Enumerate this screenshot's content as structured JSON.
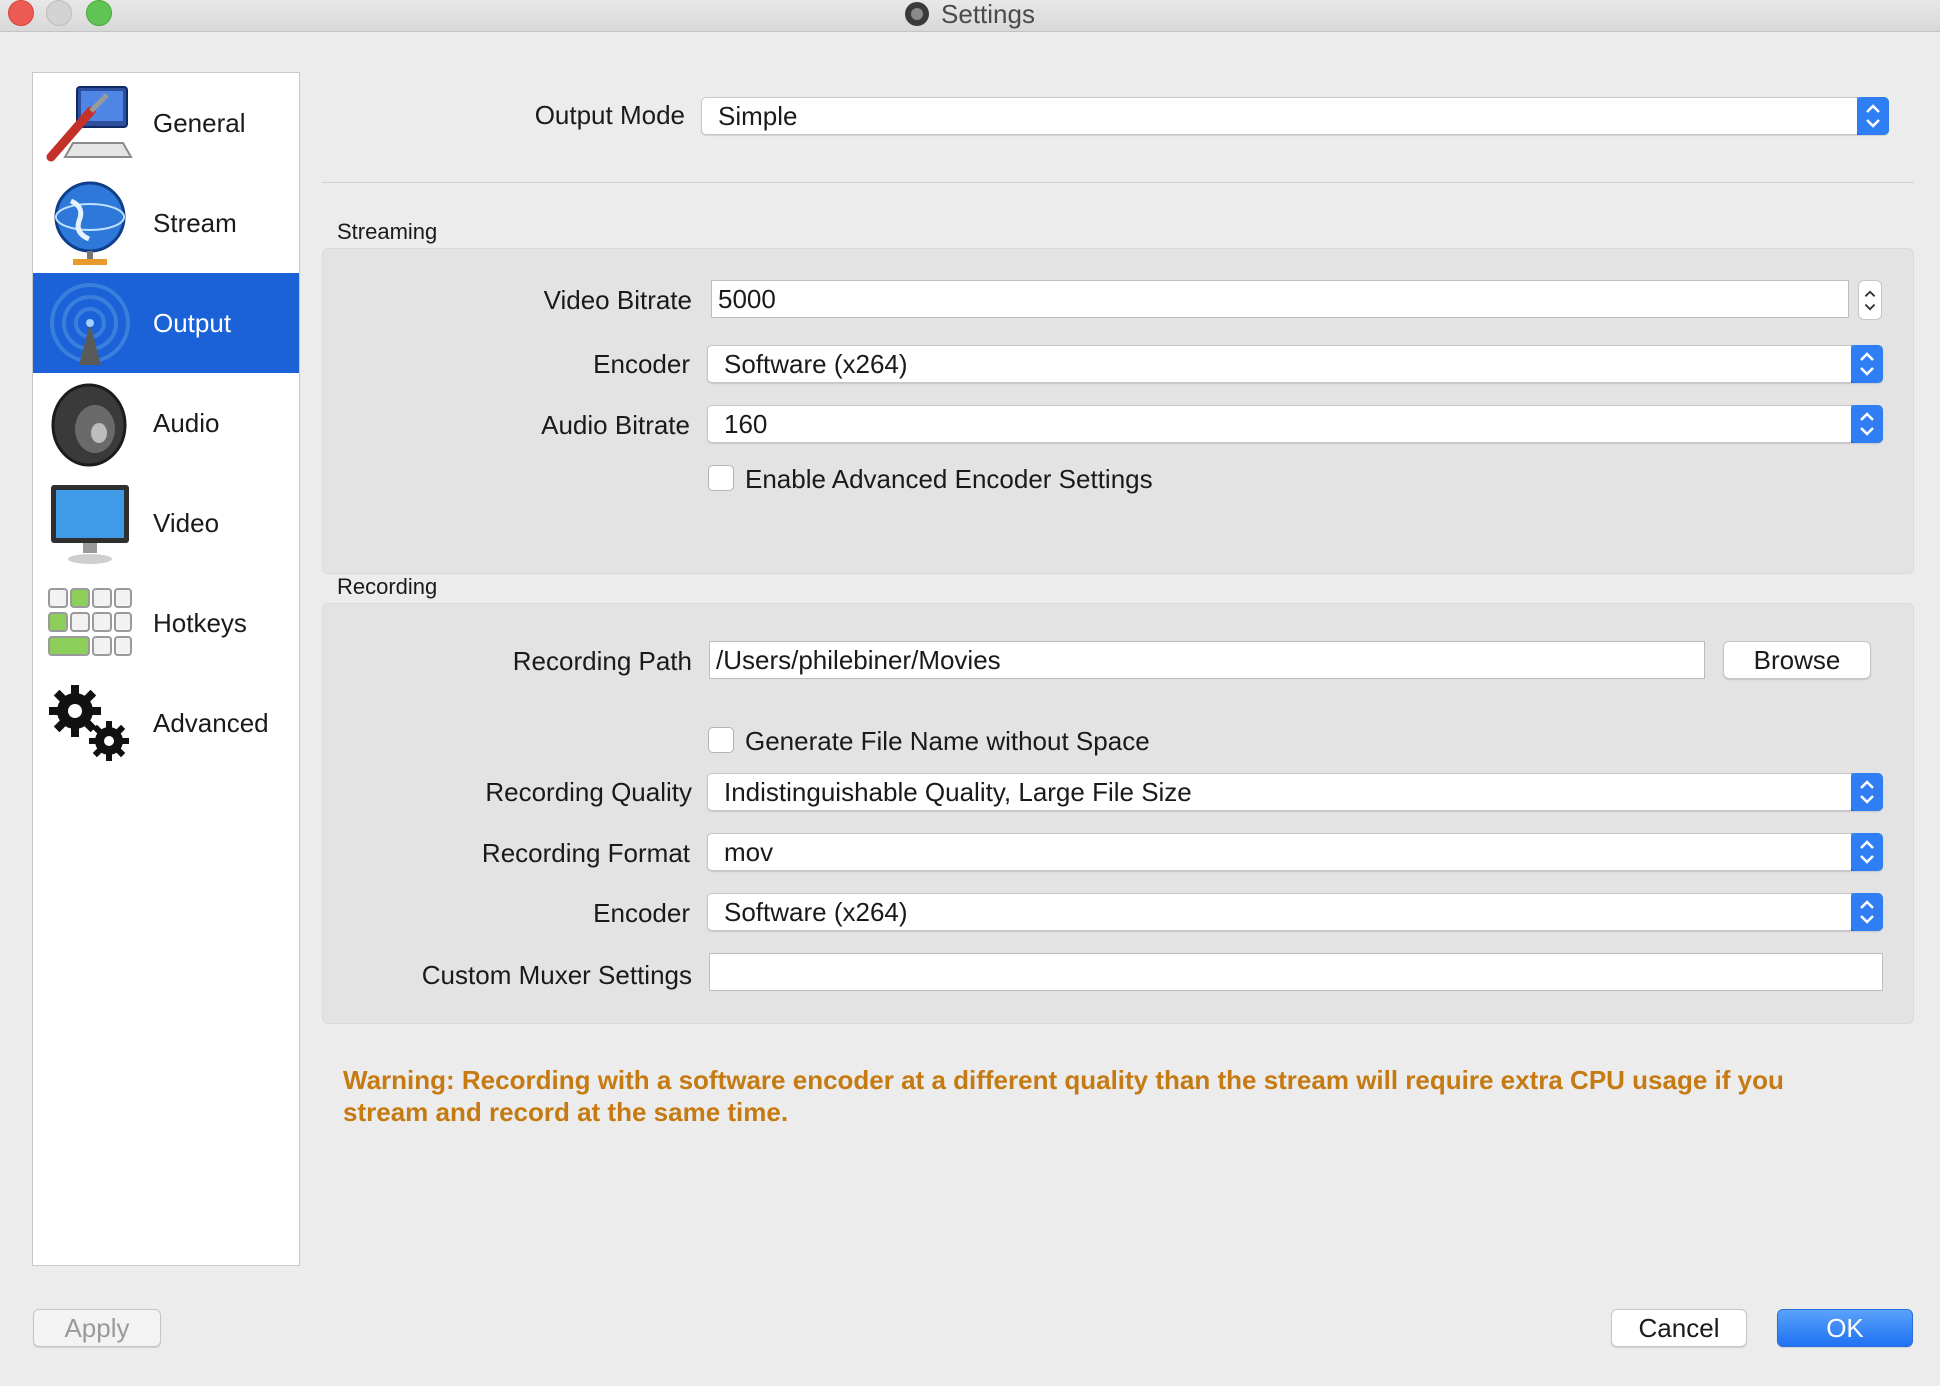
{
  "window": {
    "title": "Settings"
  },
  "sidebar": {
    "items": [
      {
        "label": "General",
        "icon": "general-icon",
        "active": false
      },
      {
        "label": "Stream",
        "icon": "globe-icon",
        "active": false
      },
      {
        "label": "Output",
        "icon": "broadcast-icon",
        "active": true
      },
      {
        "label": "Audio",
        "icon": "speaker-icon",
        "active": false
      },
      {
        "label": "Video",
        "icon": "monitor-icon",
        "active": false
      },
      {
        "label": "Hotkeys",
        "icon": "keyboard-icon",
        "active": false
      },
      {
        "label": "Advanced",
        "icon": "gears-icon",
        "active": false
      }
    ],
    "active_color": "#1b62d9"
  },
  "output_mode": {
    "label": "Output Mode",
    "value": "Simple"
  },
  "streaming": {
    "title": "Streaming",
    "video_bitrate": {
      "label": "Video Bitrate",
      "value": "5000"
    },
    "encoder": {
      "label": "Encoder",
      "value": "Software (x264)"
    },
    "audio_bitrate": {
      "label": "Audio Bitrate",
      "value": "160"
    },
    "advanced_encoder": {
      "label": "Enable Advanced Encoder Settings",
      "checked": false
    }
  },
  "recording": {
    "title": "Recording",
    "path": {
      "label": "Recording Path",
      "value": "/Users/philebiner/Movies",
      "browse_label": "Browse"
    },
    "no_space": {
      "label": "Generate File Name without Space",
      "checked": false
    },
    "quality": {
      "label": "Recording Quality",
      "value": "Indistinguishable Quality, Large File Size"
    },
    "format": {
      "label": "Recording Format",
      "value": "mov"
    },
    "encoder": {
      "label": "Encoder",
      "value": "Software (x264)"
    },
    "muxer": {
      "label": "Custom Muxer Settings",
      "value": ""
    }
  },
  "warning": {
    "line1": "Warning: Recording with a software encoder at a different quality than the stream will require extra CPU usage if you",
    "line2": "stream and record at the same time.",
    "color": "#c57a12"
  },
  "footer": {
    "apply": "Apply",
    "cancel": "Cancel",
    "ok": "OK"
  },
  "colors": {
    "accent": "#1f72f2",
    "warning": "#c57a12"
  }
}
